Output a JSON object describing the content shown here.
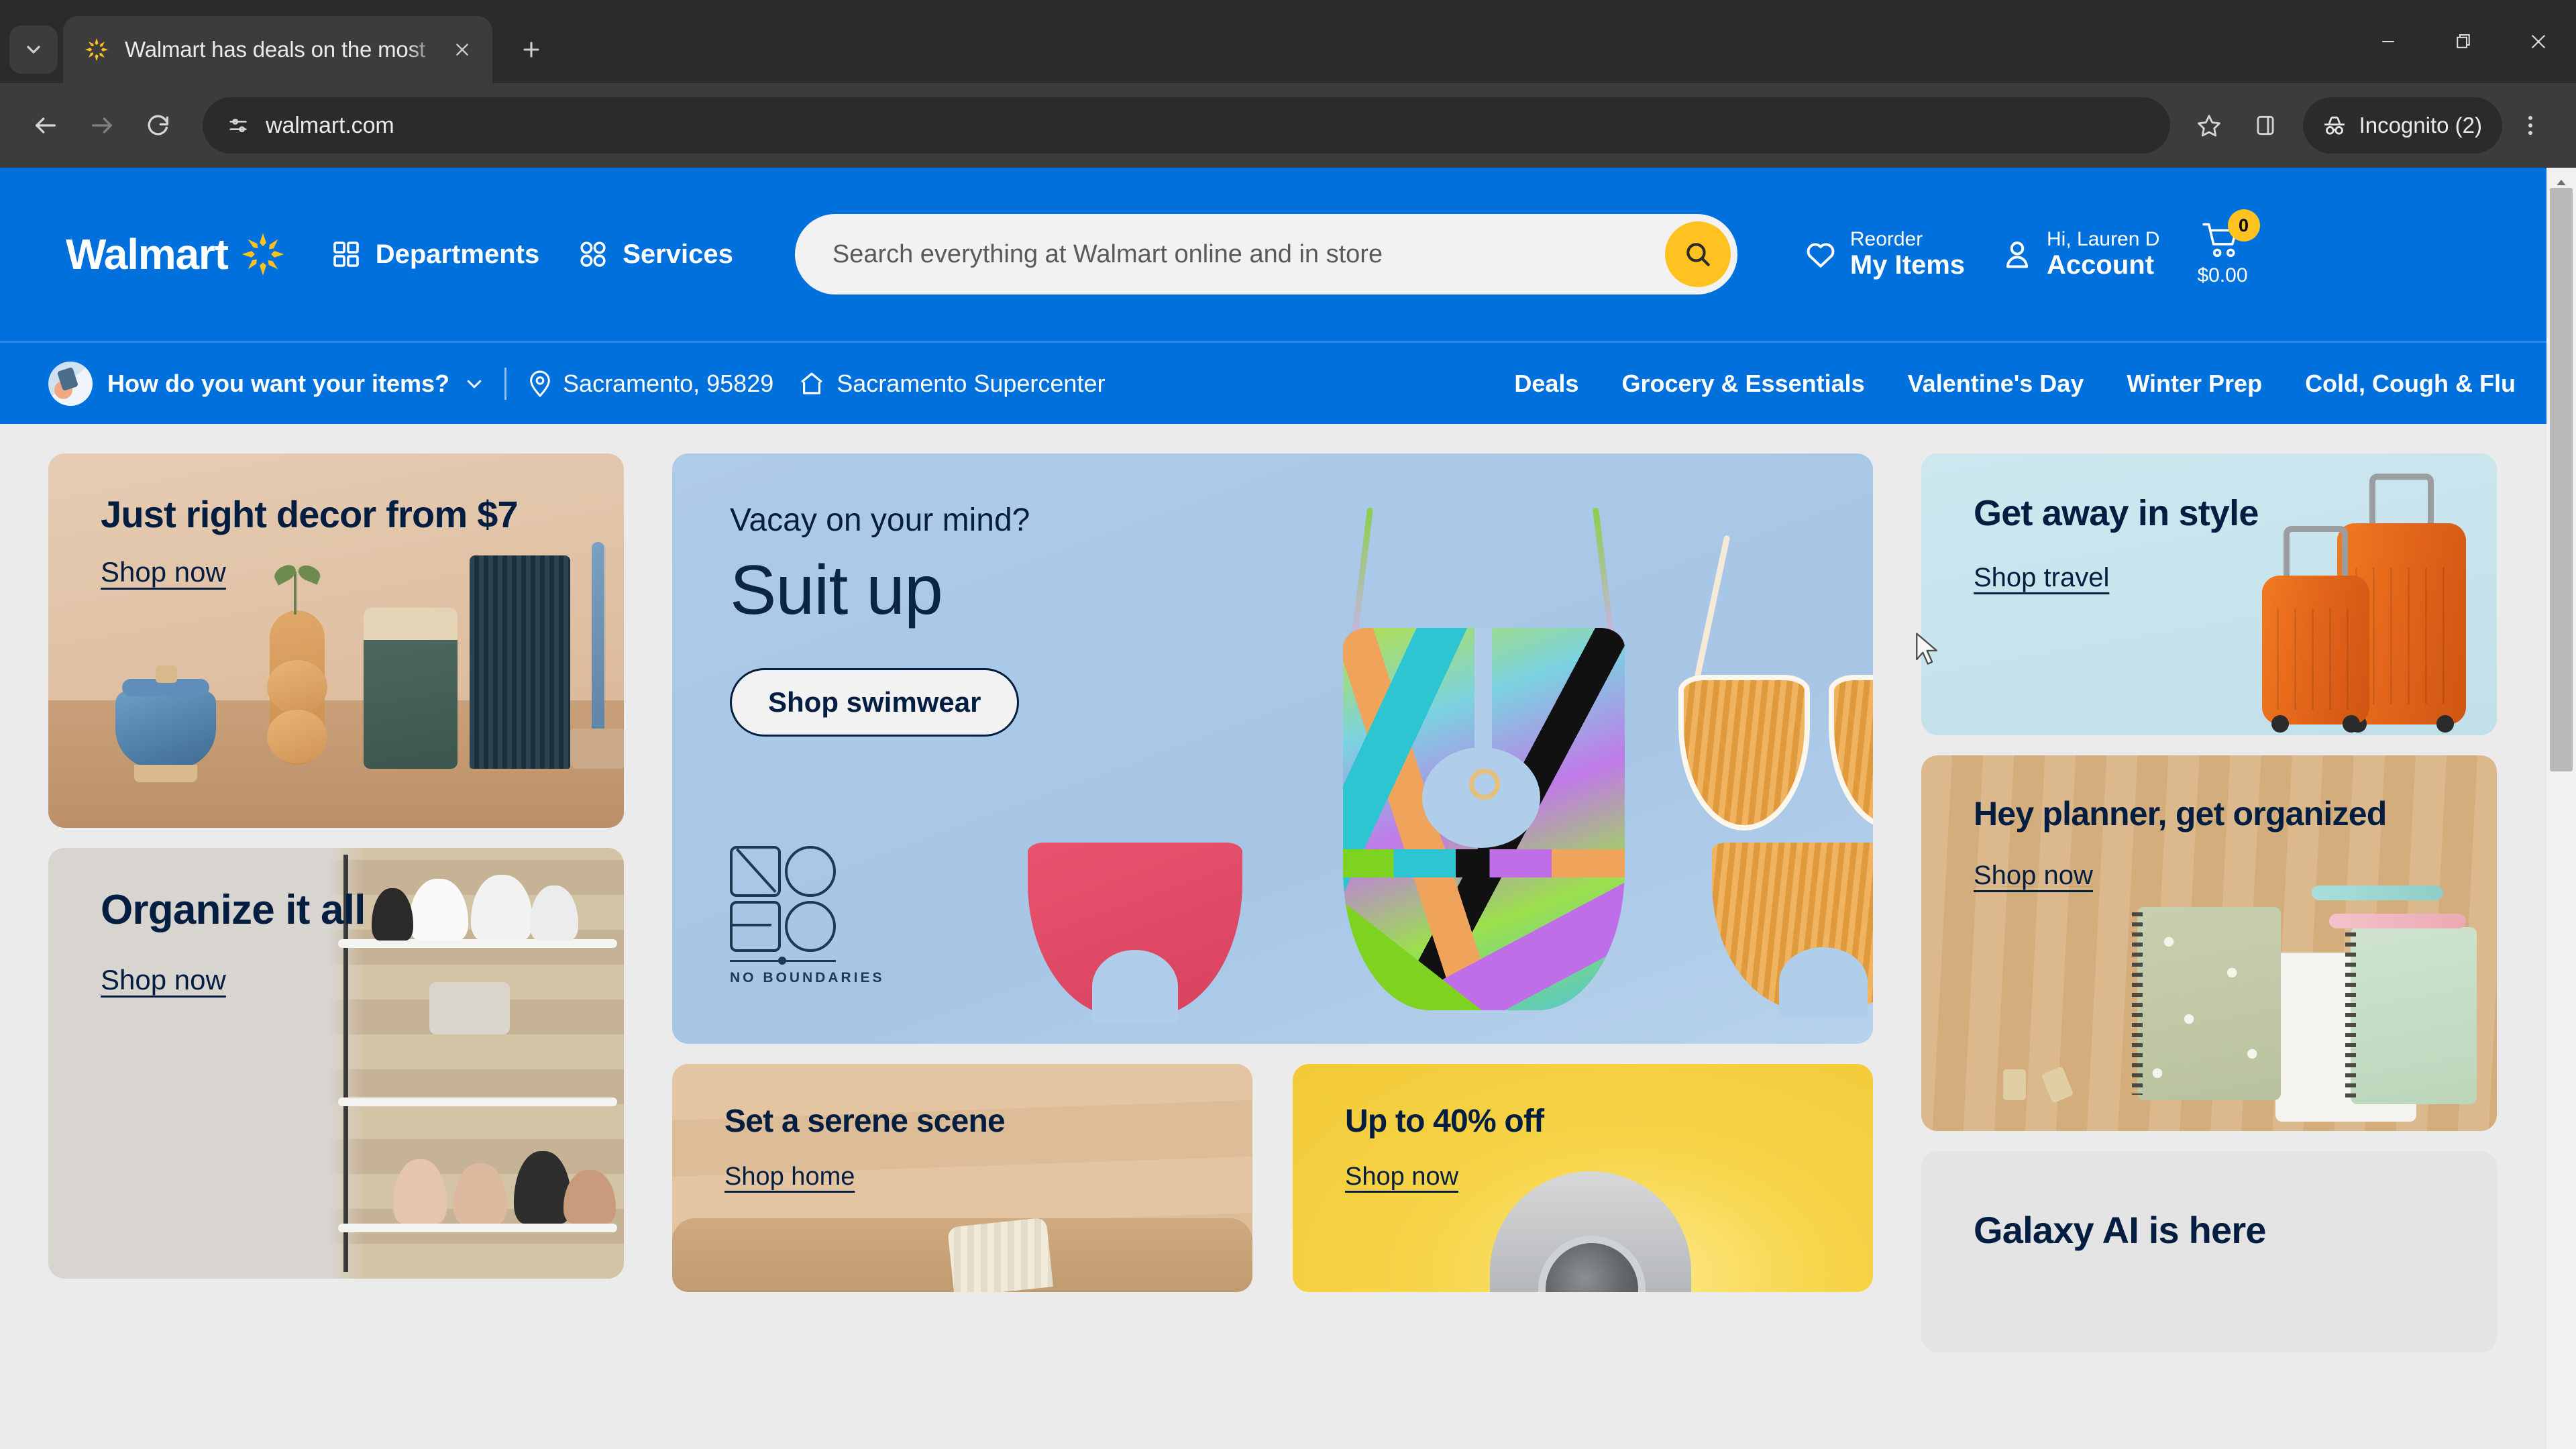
{
  "browser": {
    "tab": {
      "title": "Walmart has deals on the most",
      "favicon_icon": "walmart-spark-icon",
      "close_icon": "close-icon"
    },
    "tab_search_icon": "chevron-down-icon",
    "new_tab_icon": "plus-icon",
    "window_controls": {
      "minimize_icon": "minimize-icon",
      "restore_icon": "restore-icon",
      "close_icon": "close-icon"
    },
    "toolbar": {
      "back_icon": "back-arrow-icon",
      "forward_icon": "forward-arrow-icon",
      "reload_icon": "reload-icon",
      "site_info_icon": "site-settings-icon",
      "url": "walmart.com",
      "bookmark_icon": "star-icon",
      "side_panel_icon": "side-panel-icon",
      "incognito_icon": "incognito-hat-icon",
      "incognito_label": "Incognito (2)",
      "menu_icon": "three-dot-menu-icon"
    }
  },
  "header": {
    "logo_text": "Walmart",
    "logo_icon": "walmart-spark-icon",
    "departments": {
      "label": "Departments",
      "icon": "grid-icon"
    },
    "services": {
      "label": "Services",
      "icon": "circles-grid-icon"
    },
    "search": {
      "placeholder": "Search everything at Walmart online and in store",
      "submit_icon": "search-icon"
    },
    "reorder": {
      "sub": "Reorder",
      "main": "My Items",
      "icon": "heart-icon"
    },
    "account": {
      "sub": "Hi, Lauren D",
      "main": "Account",
      "icon": "person-icon"
    },
    "cart": {
      "count": "0",
      "price": "$0.00",
      "icon": "cart-icon"
    }
  },
  "subnav": {
    "fulfillment": {
      "label": "How do you want your items?",
      "avatar_icon": "user-avatar-icon",
      "chevron_icon": "chevron-down-icon"
    },
    "location": {
      "label": "Sacramento, 95829",
      "icon": "location-pin-icon"
    },
    "store": {
      "label": "Sacramento Supercenter",
      "icon": "store-icon"
    },
    "categories": [
      "Deals",
      "Grocery & Essentials",
      "Valentine's Day",
      "Winter Prep",
      "Cold, Cough & Flu"
    ]
  },
  "cards": {
    "decor": {
      "title": "Just right decor from $7",
      "link": "Shop now"
    },
    "organize": {
      "title": "Organize it all",
      "link": "Shop now"
    },
    "hero": {
      "kicker": "Vacay on your mind?",
      "title": "Suit up",
      "cta": "Shop swimwear",
      "brand_line1": "NO",
      "brand_line2": "BO",
      "brand_sub": "NO BOUNDARIES"
    },
    "serene": {
      "title": "Set a serene scene",
      "link": "Shop home"
    },
    "deal40": {
      "title": "Up to 40% off",
      "link": "Shop now"
    },
    "travel": {
      "title": "Get away in style",
      "link": "Shop travel"
    },
    "planner": {
      "title": "Hey planner, get organized",
      "link": "Shop now"
    },
    "galaxy": {
      "title": "Galaxy AI is here"
    }
  },
  "scrollbar": {
    "up_arrow_icon": "caret-up-icon"
  },
  "colors": {
    "walmart_blue": "#0071dc",
    "walmart_yellow": "#ffc220",
    "navy_text": "#041e42",
    "page_bg": "#ebebeb"
  }
}
